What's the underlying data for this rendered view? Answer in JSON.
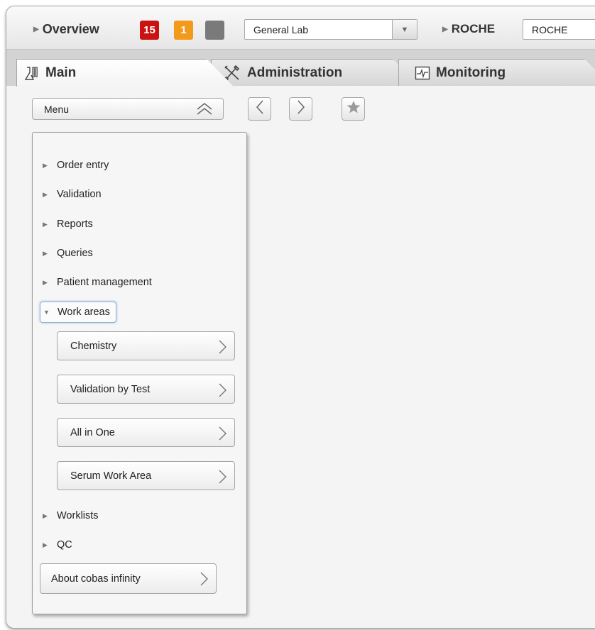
{
  "topbar": {
    "overview_label": "Overview",
    "badge_red": "15",
    "badge_orange": "1",
    "badge_gray": "",
    "lab_select_value": "General Lab",
    "roche_label": "ROCHE",
    "roche_select_value": "ROCHE",
    "colors": {
      "badge_red": "#cc1111",
      "badge_orange": "#f49a1a",
      "badge_gray": "#7a7a7a"
    }
  },
  "tabs": [
    {
      "label": "Main",
      "icon": "lab-flask-icon",
      "active": true
    },
    {
      "label": "Administration",
      "icon": "tools-icon",
      "active": false
    },
    {
      "label": "Monitoring",
      "icon": "monitor-icon",
      "active": false
    }
  ],
  "toolbar": {
    "menu_label": "Menu",
    "back_icon": "chevron-left-icon",
    "forward_icon": "chevron-right-icon",
    "favorite_icon": "star-icon"
  },
  "menu": {
    "items": [
      {
        "label": "Order entry",
        "expanded": false
      },
      {
        "label": "Validation",
        "expanded": false
      },
      {
        "label": "Reports",
        "expanded": false
      },
      {
        "label": "Queries",
        "expanded": false
      },
      {
        "label": "Patient management",
        "expanded": false
      },
      {
        "label": "Work areas",
        "expanded": true
      },
      {
        "label": "Worklists",
        "expanded": false
      },
      {
        "label": "QC",
        "expanded": false
      }
    ],
    "work_areas": [
      {
        "label": "Chemistry"
      },
      {
        "label": "Validation by Test"
      },
      {
        "label": "All in One"
      },
      {
        "label": "Serum Work Area"
      }
    ],
    "about_label": "About cobas infinity"
  }
}
